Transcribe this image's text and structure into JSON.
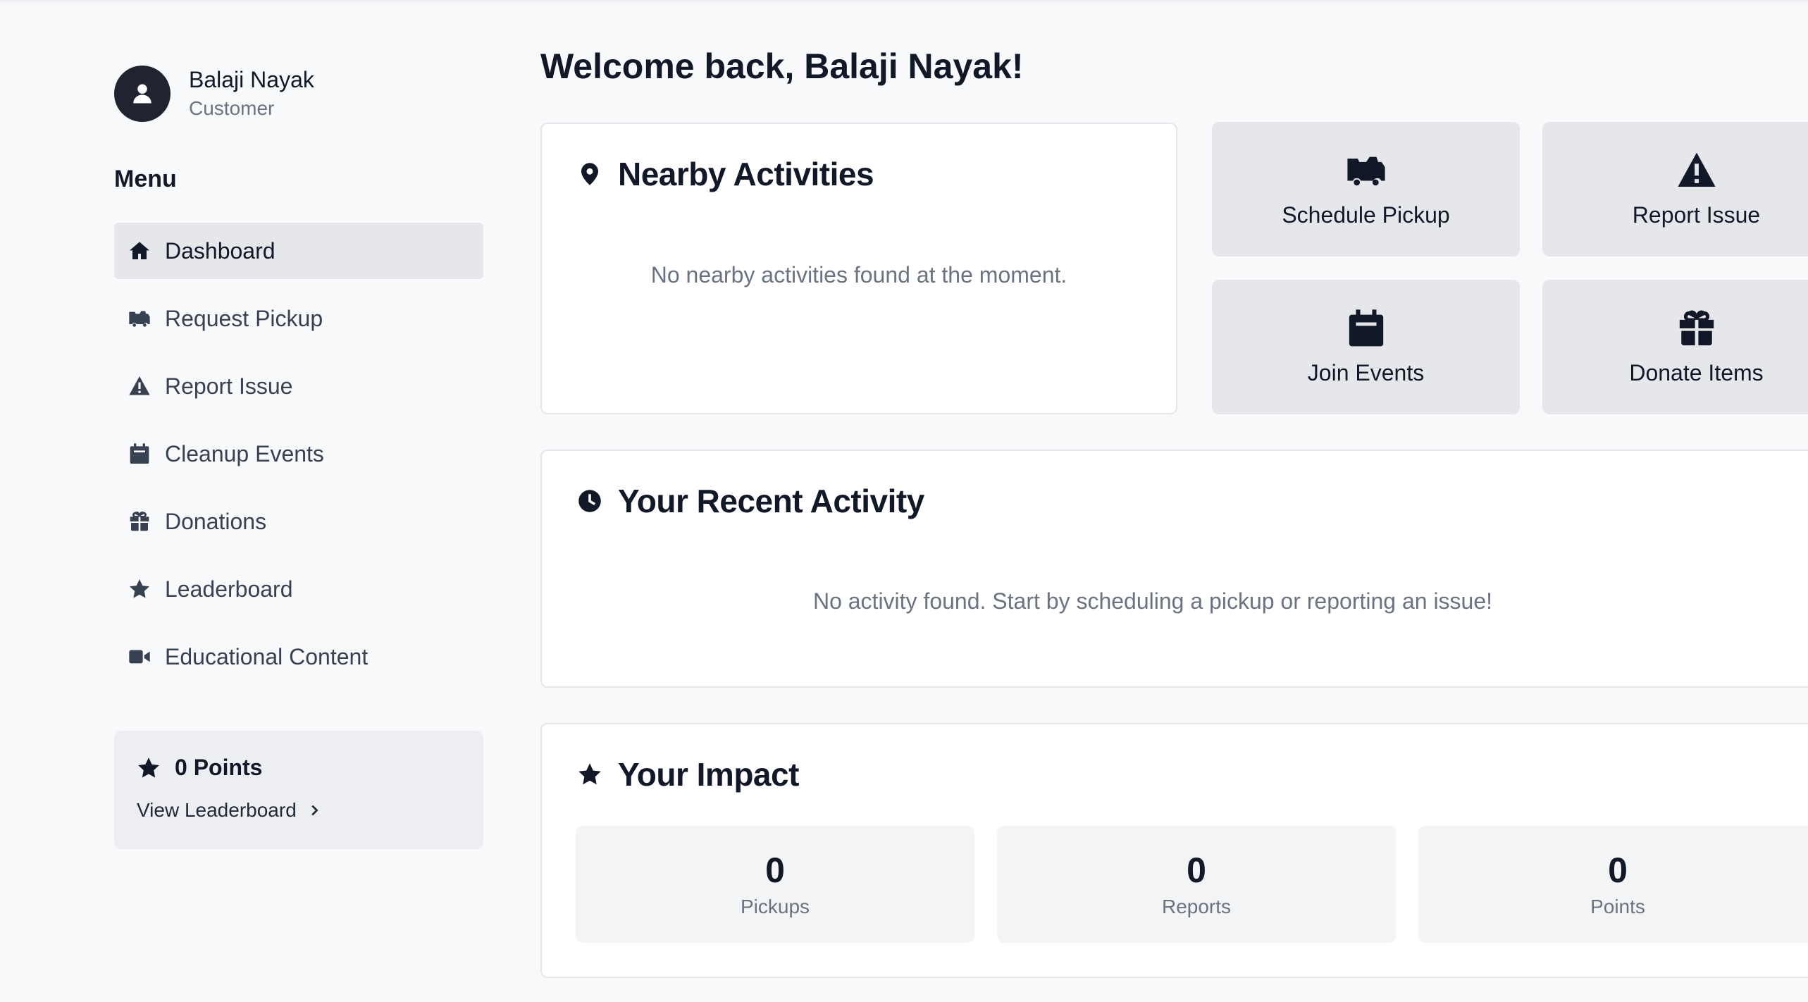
{
  "user": {
    "name": "Balaji Nayak",
    "role": "Customer"
  },
  "sidebar": {
    "menu_title": "Menu",
    "items": [
      {
        "label": "Dashboard",
        "icon": "home-icon",
        "active": true
      },
      {
        "label": "Request Pickup",
        "icon": "truck-icon"
      },
      {
        "label": "Report Issue",
        "icon": "warning-icon"
      },
      {
        "label": "Cleanup Events",
        "icon": "calendar-icon"
      },
      {
        "label": "Donations",
        "icon": "gift-icon"
      },
      {
        "label": "Leaderboard",
        "icon": "star-icon"
      },
      {
        "label": "Educational Content",
        "icon": "video-icon"
      }
    ],
    "points": {
      "label": "0 Points",
      "link": "View Leaderboard"
    }
  },
  "main": {
    "welcome": "Welcome back, Balaji Nayak!",
    "nearby": {
      "title": "Nearby Activities",
      "empty": "No nearby activities found at the moment."
    },
    "quick_actions": [
      {
        "label": "Schedule Pickup",
        "icon": "truck-icon"
      },
      {
        "label": "Report Issue",
        "icon": "warning-icon"
      },
      {
        "label": "Join Events",
        "icon": "calendar-icon"
      },
      {
        "label": "Donate Items",
        "icon": "gift-icon"
      }
    ],
    "recent": {
      "title": "Your Recent Activity",
      "empty": "No activity found. Start by scheduling a pickup or reporting an issue!"
    },
    "impact": {
      "title": "Your Impact",
      "stats": [
        {
          "value": "0",
          "label": "Pickups"
        },
        {
          "value": "0",
          "label": "Reports"
        },
        {
          "value": "0",
          "label": "Points"
        }
      ]
    }
  },
  "colors": {
    "background": "#f8f9fb",
    "active_nav": "#e5e7eb",
    "text": "#111827",
    "muted": "#6b7280"
  }
}
